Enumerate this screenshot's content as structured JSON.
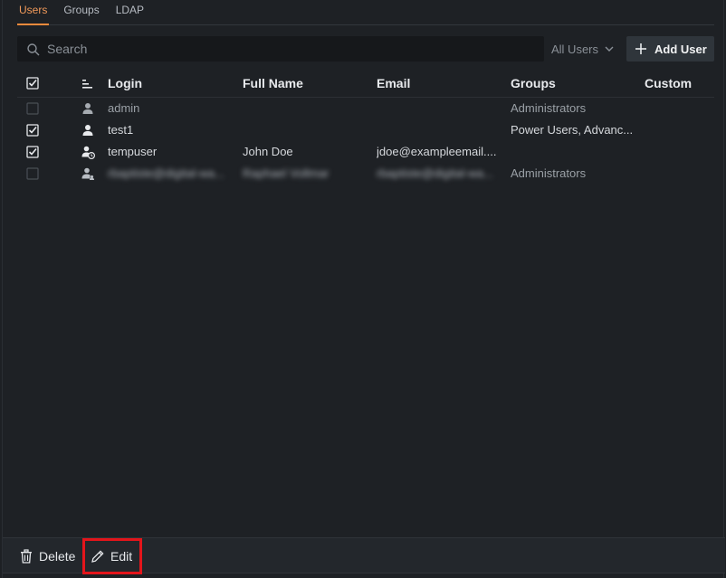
{
  "tabs": [
    {
      "label": "Users",
      "active": true
    },
    {
      "label": "Groups",
      "active": false
    },
    {
      "label": "LDAP",
      "active": false
    }
  ],
  "search": {
    "placeholder": "Search",
    "value": ""
  },
  "filter": {
    "label": "All Users"
  },
  "add_user": {
    "label": "Add User"
  },
  "table": {
    "columns": {
      "login": "Login",
      "full_name": "Full Name",
      "email": "Email",
      "groups": "Groups",
      "custom": "Custom"
    },
    "header_checked": true,
    "rows": [
      {
        "checked": false,
        "icon": "user-icon",
        "login": "admin",
        "full_name": "",
        "email": "",
        "groups": "Administrators",
        "custom": ""
      },
      {
        "checked": true,
        "icon": "user-icon",
        "login": "test1",
        "full_name": "",
        "email": "",
        "groups": "Power Users, Advanc...",
        "custom": ""
      },
      {
        "checked": true,
        "icon": "temp-user-icon",
        "login": "tempuser",
        "full_name": "John Doe",
        "email": "jdoe@exampleemail....",
        "groups": "",
        "custom": ""
      },
      {
        "checked": false,
        "icon": "ldap-user-icon",
        "login": "rbaptiste@digital-wa...",
        "full_name": "Raphael Vollmar",
        "email": "rbaptiste@digital-wa...",
        "groups": "Administrators",
        "custom": ""
      }
    ]
  },
  "footer": {
    "delete_label": "Delete",
    "edit_label": "Edit"
  },
  "colors": {
    "accent": "#f08a3c",
    "highlight": "#e3151b",
    "background": "#1e2125"
  }
}
